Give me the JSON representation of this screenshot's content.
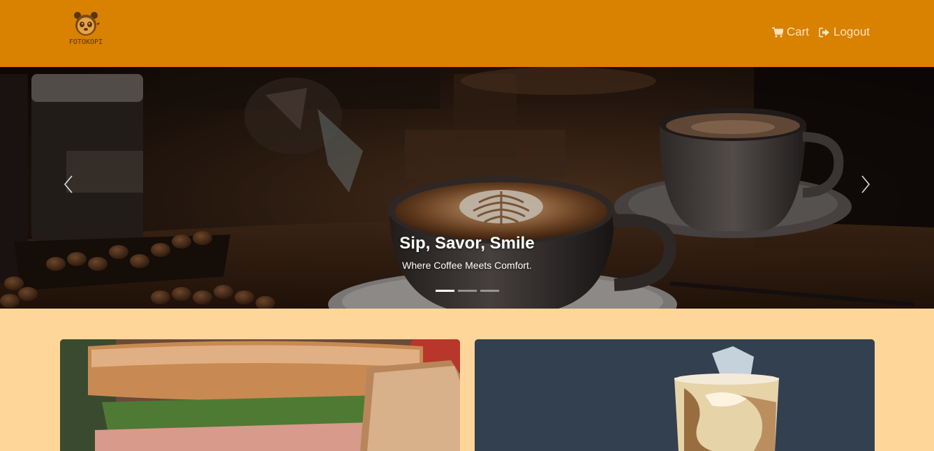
{
  "brand": {
    "name": "FOTOKOPI",
    "icon": "panda-logo-icon"
  },
  "nav": {
    "cart_label": "Cart",
    "cart_icon": "shopping-cart-icon",
    "logout_label": "Logout",
    "logout_icon": "sign-out-icon"
  },
  "carousel": {
    "slide_title": "Sip, Savor, Smile",
    "slide_text": "Where Coffee Meets Comfort.",
    "slide_count": 3,
    "active_slide": 1
  },
  "cards": [
    {
      "image": "sandwich-photo"
    },
    {
      "image": "iced-coffee-photo"
    }
  ],
  "colors": {
    "navbar": "#D98100",
    "page_background": "#FFD699",
    "nav_text": "#FCE5BF"
  }
}
